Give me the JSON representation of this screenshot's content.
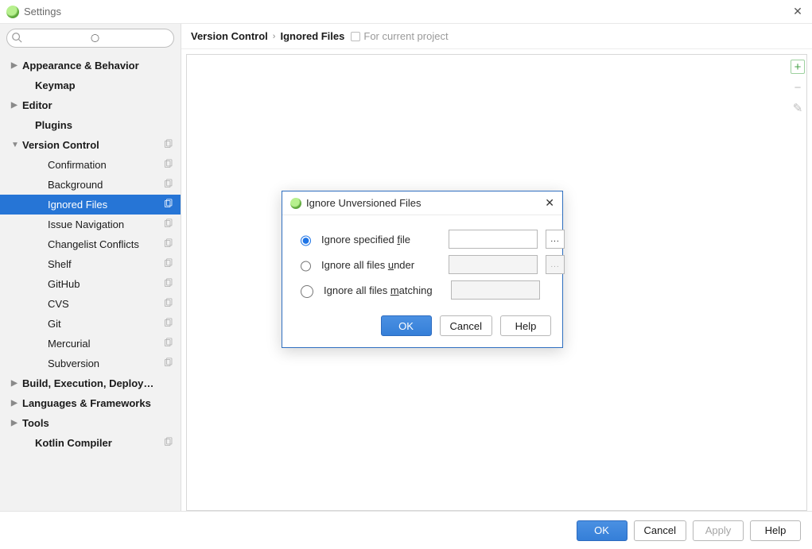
{
  "window": {
    "title": "Settings"
  },
  "search": {
    "placeholder": ""
  },
  "tree": [
    {
      "label": "Appearance & Behavior",
      "bold": true,
      "arrow": "▶",
      "indent": 0,
      "copy": false
    },
    {
      "label": "Keymap",
      "bold": true,
      "arrow": "",
      "indent": 1,
      "copy": false
    },
    {
      "label": "Editor",
      "bold": true,
      "arrow": "▶",
      "indent": 0,
      "copy": false
    },
    {
      "label": "Plugins",
      "bold": true,
      "arrow": "",
      "indent": 1,
      "copy": false
    },
    {
      "label": "Version Control",
      "bold": true,
      "arrow": "▼",
      "indent": 0,
      "copy": true,
      "expanded": true
    },
    {
      "label": "Confirmation",
      "bold": false,
      "arrow": "",
      "indent": 2,
      "copy": true
    },
    {
      "label": "Background",
      "bold": false,
      "arrow": "",
      "indent": 2,
      "copy": true
    },
    {
      "label": "Ignored Files",
      "bold": false,
      "arrow": "",
      "indent": 2,
      "copy": true,
      "selected": true
    },
    {
      "label": "Issue Navigation",
      "bold": false,
      "arrow": "",
      "indent": 2,
      "copy": true
    },
    {
      "label": "Changelist Conflicts",
      "bold": false,
      "arrow": "",
      "indent": 2,
      "copy": true
    },
    {
      "label": "Shelf",
      "bold": false,
      "arrow": "",
      "indent": 2,
      "copy": true
    },
    {
      "label": "GitHub",
      "bold": false,
      "arrow": "",
      "indent": 2,
      "copy": true
    },
    {
      "label": "CVS",
      "bold": false,
      "arrow": "",
      "indent": 2,
      "copy": true
    },
    {
      "label": "Git",
      "bold": false,
      "arrow": "",
      "indent": 2,
      "copy": true
    },
    {
      "label": "Mercurial",
      "bold": false,
      "arrow": "",
      "indent": 2,
      "copy": true
    },
    {
      "label": "Subversion",
      "bold": false,
      "arrow": "",
      "indent": 2,
      "copy": true
    },
    {
      "label": "Build, Execution, Deployment",
      "bold": true,
      "arrow": "▶",
      "indent": 0,
      "copy": false
    },
    {
      "label": "Languages & Frameworks",
      "bold": true,
      "arrow": "▶",
      "indent": 0,
      "copy": false
    },
    {
      "label": "Tools",
      "bold": true,
      "arrow": "▶",
      "indent": 0,
      "copy": false
    },
    {
      "label": "Kotlin Compiler",
      "bold": true,
      "arrow": "",
      "indent": 1,
      "copy": true
    }
  ],
  "breadcrumb": {
    "parent": "Version Control",
    "current": "Ignored Files",
    "scope": "For current project"
  },
  "toolbar": {
    "add": "+",
    "remove": "−",
    "edit": "✎"
  },
  "buttons": {
    "ok": "OK",
    "cancel": "Cancel",
    "apply": "Apply",
    "help": "Help"
  },
  "dialog": {
    "title": "Ignore Unversioned Files",
    "options": {
      "specified": "Ignore specified file",
      "under": "Ignore all files under",
      "matching": "Ignore all files matching"
    },
    "values": {
      "specified": "",
      "under": "",
      "matching": ""
    },
    "selected": "specified",
    "browse": "...",
    "buttons": {
      "ok": "OK",
      "cancel": "Cancel",
      "help": "Help"
    }
  }
}
